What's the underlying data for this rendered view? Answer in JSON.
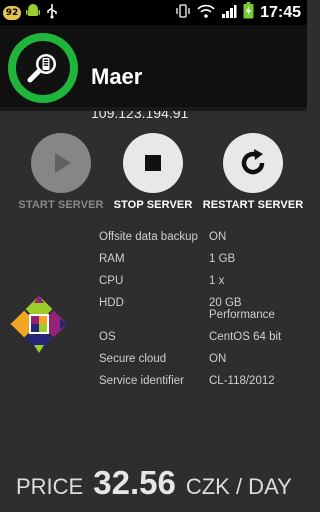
{
  "statusbar": {
    "notification_count": "92",
    "time": "17:45",
    "icons": [
      "android-icon",
      "usb-icon",
      "vibrate-icon",
      "wifi-icon",
      "signal-icon",
      "battery-charging-icon"
    ]
  },
  "server": {
    "name": "Maer",
    "ip": "109.123.194.91"
  },
  "actions": {
    "start_label": "START SERVER",
    "stop_label": "STOP SERVER",
    "restart_label": "RESTART SERVER"
  },
  "specs": [
    {
      "label": "Offsite data backup",
      "value": "ON"
    },
    {
      "label": "RAM",
      "value": "1 GB"
    },
    {
      "label": "CPU",
      "value": "1 x"
    },
    {
      "label": "HDD",
      "value": "20 GB Performance"
    },
    {
      "label": "OS",
      "value": "CentOS 64 bit"
    },
    {
      "label": "Secure cloud",
      "value": "ON"
    },
    {
      "label": "Service identifier",
      "value": "CL-118/2012"
    }
  ],
  "price": {
    "label": "PRICE",
    "value": "32.56",
    "unit": "CZK / DAY"
  },
  "colors": {
    "accent_green": "#1fb53a",
    "background": "#2e2e2e",
    "header": "#101010"
  }
}
